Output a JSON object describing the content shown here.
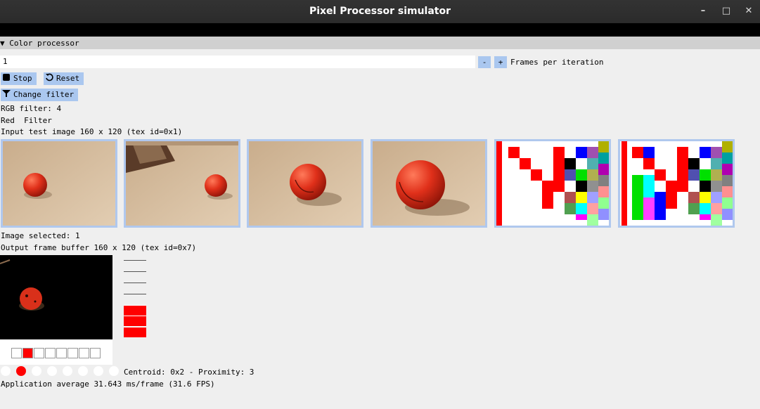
{
  "window": {
    "title": "Pixel Processor simulator",
    "min": "–",
    "max": "□",
    "close": "✕"
  },
  "section": {
    "label": "▼ Color processor"
  },
  "controls": {
    "frames_value": "1",
    "minus_label": "-",
    "plus_label": "+",
    "frames_label": "Frames per iteration",
    "stop_label": "Stop",
    "reset_label": "Reset",
    "change_filter_label": "Change filter"
  },
  "info": {
    "rgb_filter": "RGB filter: 4",
    "filter_name": "Red  Filter",
    "input_caption": "Input test image 160 x 120 (tex id=0x1)",
    "image_selected": "Image selected: 1",
    "output_caption": "Output frame buffer 160 x 120 (tex id=0x7)",
    "centroid": "Centroid: 0x2 - Proximity: 3",
    "app_avg": "Application average 31.643 ms/frame (31.6 FPS)"
  },
  "thumbnails": [
    {
      "name": "ball-far"
    },
    {
      "name": "ball-right-box"
    },
    {
      "name": "ball-mid"
    },
    {
      "name": "ball-close"
    },
    {
      "name": "pattern-a"
    },
    {
      "name": "pattern-b"
    }
  ],
  "histogram_cells": [
    false,
    true,
    false,
    false,
    false,
    false,
    false,
    false
  ],
  "indicator_dots": [
    false,
    true,
    false,
    false,
    false,
    false,
    false,
    false
  ],
  "colors": {
    "accent": "#aac7ef",
    "red": "#ff0000",
    "ball": "#d9301a"
  }
}
